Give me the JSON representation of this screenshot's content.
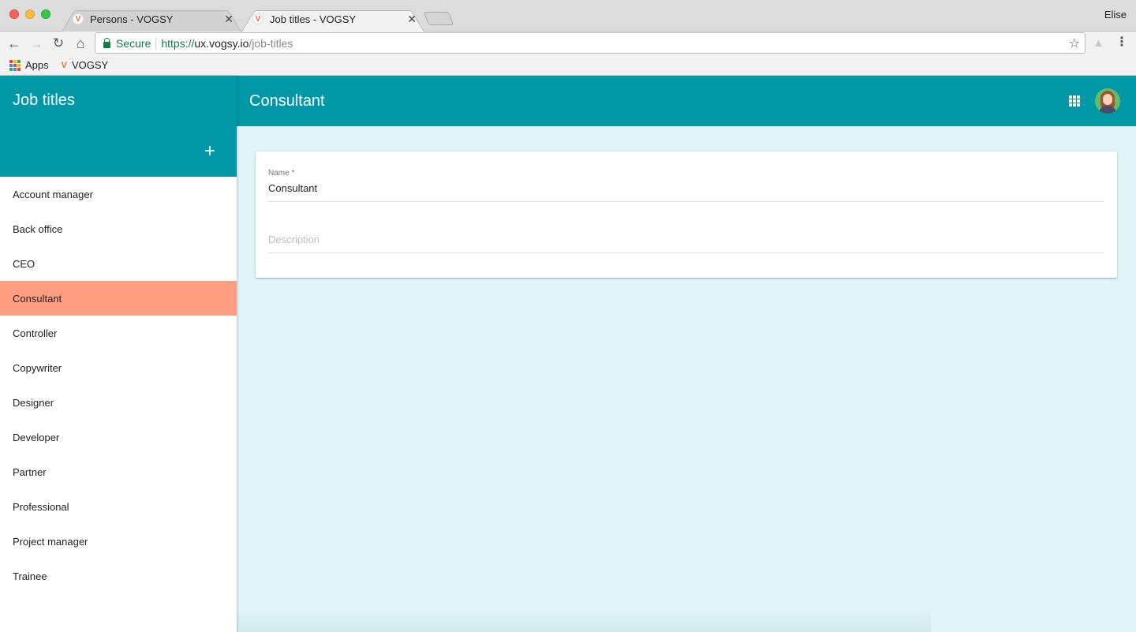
{
  "browser": {
    "tabs": [
      {
        "title": "Persons - VOGSY",
        "active": false
      },
      {
        "title": "Job titles - VOGSY",
        "active": true
      }
    ],
    "profile_name": "Elise",
    "address": {
      "security_label": "Secure",
      "scheme": "https://",
      "host": "ux.vogsy.io",
      "path": "/job-titles"
    },
    "bookmarks": [
      {
        "label": "Apps",
        "icon": "apps-grid-icon"
      },
      {
        "label": "VOGSY",
        "icon": "vogsy-favicon-icon"
      }
    ],
    "icons": {
      "back": "←",
      "forward": "→",
      "reload": "↻",
      "home": "⌂",
      "star": "☆",
      "close": "✕",
      "menu": "⋮",
      "add": "+"
    },
    "apps_colors": [
      "#ea4335",
      "#fbbc05",
      "#34a853",
      "#4285f4",
      "#ea4335",
      "#fbbc05",
      "#34a853",
      "#4285f4",
      "#ea4335"
    ]
  },
  "sidebar": {
    "title": "Job titles",
    "items": [
      {
        "label": "Account manager"
      },
      {
        "label": "Back office"
      },
      {
        "label": "CEO"
      },
      {
        "label": "Consultant",
        "selected": true
      },
      {
        "label": "Controller"
      },
      {
        "label": "Copywriter"
      },
      {
        "label": "Designer"
      },
      {
        "label": "Developer"
      },
      {
        "label": "Partner"
      },
      {
        "label": "Professional"
      },
      {
        "label": "Project manager"
      },
      {
        "label": "Trainee"
      }
    ]
  },
  "appbar": {
    "title": "Consultant"
  },
  "form": {
    "name_label": "Name *",
    "name_value": "Consultant",
    "description_placeholder": "Description",
    "description_value": ""
  },
  "colors": {
    "primary": "#0097a7",
    "selected": "#ff9e80",
    "background": "#dff5f8"
  }
}
